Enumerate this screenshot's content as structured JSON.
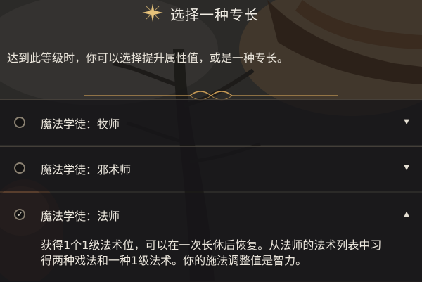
{
  "header": {
    "title": "选择一种专长",
    "star_icon": "sparkle-star-icon",
    "subtitle": "达到此等级时，你可以选择提升属性值，或是一种专长。"
  },
  "options": [
    {
      "label": "魔法学徒：牧师",
      "selected": false,
      "expanded": false,
      "caret": "▼"
    },
    {
      "label": "魔法学徒：邪术师",
      "selected": false,
      "expanded": false,
      "caret": "▼"
    },
    {
      "label": "魔法学徒：法师",
      "selected": true,
      "expanded": true,
      "caret": "▲",
      "description": "获得1个1级法术位，可以在一次长休后恢复。从法师的法术列表中习得两种戏法和一种1级法术。你的施法调整值是智力。"
    }
  ],
  "colors": {
    "gold": "#c79a55",
    "panel": "#161518"
  }
}
